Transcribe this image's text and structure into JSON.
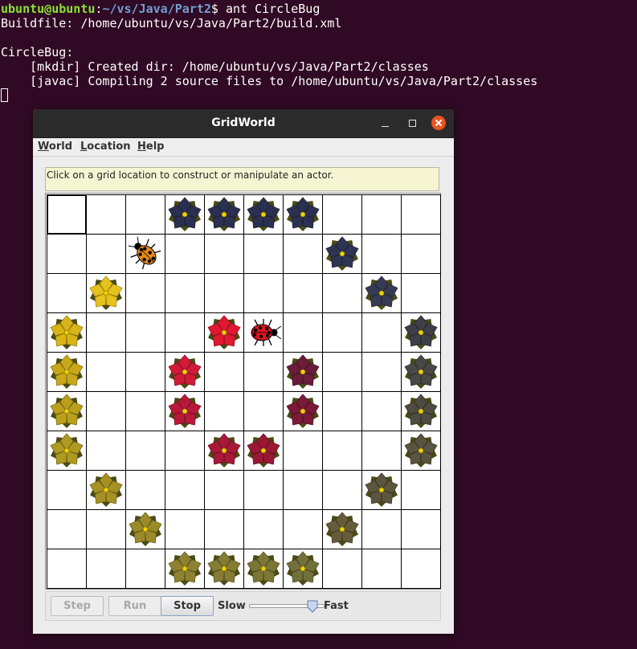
{
  "terminal": {
    "prompt_user": "ubuntu@ubuntu",
    "prompt_sep": ":",
    "prompt_path": "~/vs/Java/Part2",
    "prompt_end": "$ ant CircleBug",
    "line_buildfile": "Buildfile: /home/ubuntu/vs/Java/Part2/build.xml",
    "line_target": "CircleBug:",
    "line_mkdir": "    [mkdir] Created dir: /home/ubuntu/vs/Java/Part2/classes",
    "line_javac": "    [javac] Compiling 2 source files to /home/ubuntu/vs/Java/Part2/classes"
  },
  "window": {
    "title": "GridWorld",
    "menu": [
      "World",
      "Location",
      "Help"
    ],
    "message": "Click on a grid location to construct or manipulate an actor."
  },
  "grid": {
    "rows": 10,
    "cols": 10,
    "selected_cell": [
      0,
      0
    ],
    "actors": [
      {
        "type": "flower",
        "row": 0,
        "col": 3,
        "color": "#2b3050"
      },
      {
        "type": "flower",
        "row": 0,
        "col": 4,
        "color": "#2b3050"
      },
      {
        "type": "flower",
        "row": 0,
        "col": 5,
        "color": "#2b3050"
      },
      {
        "type": "flower",
        "row": 0,
        "col": 6,
        "color": "#2b3050"
      },
      {
        "type": "bug",
        "row": 1,
        "col": 2,
        "color": "#e88a18",
        "dir": 315
      },
      {
        "type": "flower",
        "row": 1,
        "col": 7,
        "color": "#2e3452"
      },
      {
        "type": "flower",
        "row": 2,
        "col": 1,
        "color": "#e6c21c"
      },
      {
        "type": "flower",
        "row": 2,
        "col": 8,
        "color": "#363a52"
      },
      {
        "type": "flower",
        "row": 3,
        "col": 0,
        "color": "#d8b418"
      },
      {
        "type": "flower",
        "row": 3,
        "col": 4,
        "color": "#e01830"
      },
      {
        "type": "bug",
        "row": 3,
        "col": 5,
        "color": "#e0141e",
        "dir": 90
      },
      {
        "type": "flower",
        "row": 3,
        "col": 9,
        "color": "#3e3e48"
      },
      {
        "type": "flower",
        "row": 4,
        "col": 0,
        "color": "#c8a81a"
      },
      {
        "type": "flower",
        "row": 4,
        "col": 3,
        "color": "#d01a38"
      },
      {
        "type": "flower",
        "row": 4,
        "col": 6,
        "color": "#6a1c3a"
      },
      {
        "type": "flower",
        "row": 4,
        "col": 9,
        "color": "#484846"
      },
      {
        "type": "flower",
        "row": 5,
        "col": 0,
        "color": "#baa01c"
      },
      {
        "type": "flower",
        "row": 5,
        "col": 3,
        "color": "#b8183a"
      },
      {
        "type": "flower",
        "row": 5,
        "col": 6,
        "color": "#7a1a38"
      },
      {
        "type": "flower",
        "row": 5,
        "col": 9,
        "color": "#4e4c40"
      },
      {
        "type": "flower",
        "row": 6,
        "col": 0,
        "color": "#ae9a22"
      },
      {
        "type": "flower",
        "row": 6,
        "col": 4,
        "color": "#a81838"
      },
      {
        "type": "flower",
        "row": 6,
        "col": 5,
        "color": "#9a1834"
      },
      {
        "type": "flower",
        "row": 6,
        "col": 9,
        "color": "#585440"
      },
      {
        "type": "flower",
        "row": 7,
        "col": 1,
        "color": "#a69224"
      },
      {
        "type": "flower",
        "row": 7,
        "col": 8,
        "color": "#5c563e"
      },
      {
        "type": "flower",
        "row": 8,
        "col": 2,
        "color": "#9a8a2a"
      },
      {
        "type": "flower",
        "row": 8,
        "col": 7,
        "color": "#665c3a"
      },
      {
        "type": "flower",
        "row": 9,
        "col": 3,
        "color": "#8e8230"
      },
      {
        "type": "flower",
        "row": 9,
        "col": 4,
        "color": "#857c34"
      },
      {
        "type": "flower",
        "row": 9,
        "col": 5,
        "color": "#7c7636"
      },
      {
        "type": "flower",
        "row": 9,
        "col": 6,
        "color": "#72703a"
      }
    ]
  },
  "controls": {
    "step_label": "Step",
    "run_label": "Run",
    "stop_label": "Stop",
    "slow_label": "Slow",
    "fast_label": "Fast",
    "speed_fraction": 0.9,
    "step_enabled": false,
    "run_enabled": false,
    "stop_enabled": true
  },
  "colors": {
    "terminal_bg": "#300a24",
    "prompt_user": "#8ae234",
    "prompt_path": "#729fcf",
    "close_button": "#e95420",
    "message_bg": "#f5f5d3"
  }
}
